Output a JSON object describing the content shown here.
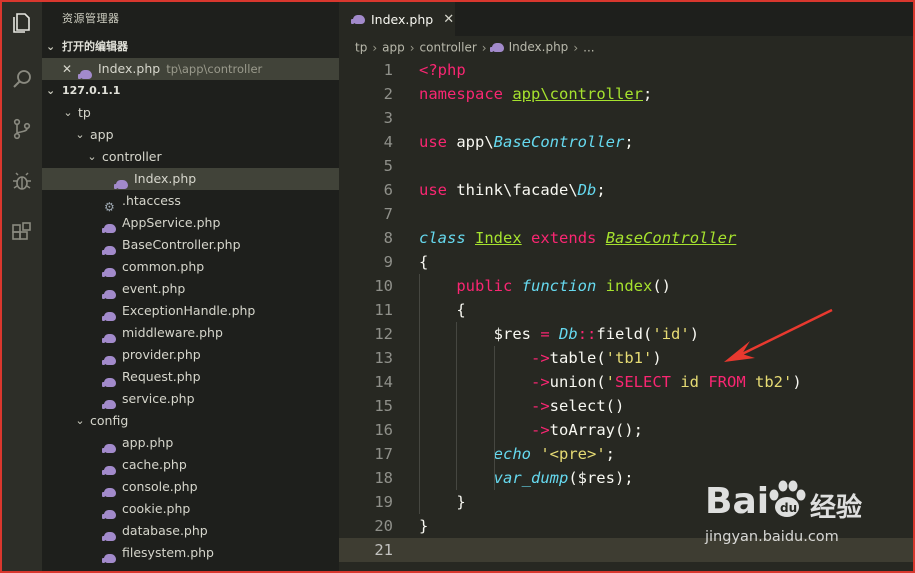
{
  "sidebar": {
    "title": "资源管理器",
    "open_editors_label": "打开的编辑器",
    "open_editor": {
      "name": "Index.php",
      "path": "tp\\app\\controller"
    },
    "workspace_label": "127.0.1.1",
    "tree": [
      {
        "name": "tp",
        "type": "folder",
        "depth": 0
      },
      {
        "name": "app",
        "type": "folder",
        "depth": 1
      },
      {
        "name": "controller",
        "type": "folder",
        "depth": 2
      },
      {
        "name": "Index.php",
        "type": "php",
        "depth": 3,
        "selected": true
      },
      {
        "name": ".htaccess",
        "type": "config",
        "depth": 2
      },
      {
        "name": "AppService.php",
        "type": "php",
        "depth": 2
      },
      {
        "name": "BaseController.php",
        "type": "php",
        "depth": 2
      },
      {
        "name": "common.php",
        "type": "php",
        "depth": 2
      },
      {
        "name": "event.php",
        "type": "php",
        "depth": 2
      },
      {
        "name": "ExceptionHandle.php",
        "type": "php",
        "depth": 2
      },
      {
        "name": "middleware.php",
        "type": "php",
        "depth": 2
      },
      {
        "name": "provider.php",
        "type": "php",
        "depth": 2
      },
      {
        "name": "Request.php",
        "type": "php",
        "depth": 2
      },
      {
        "name": "service.php",
        "type": "php",
        "depth": 2
      },
      {
        "name": "config",
        "type": "folder",
        "depth": 1
      },
      {
        "name": "app.php",
        "type": "php",
        "depth": 2
      },
      {
        "name": "cache.php",
        "type": "php",
        "depth": 2
      },
      {
        "name": "console.php",
        "type": "php",
        "depth": 2
      },
      {
        "name": "cookie.php",
        "type": "php",
        "depth": 2
      },
      {
        "name": "database.php",
        "type": "php",
        "depth": 2
      },
      {
        "name": "filesystem.php",
        "type": "php",
        "depth": 2
      }
    ]
  },
  "editor": {
    "tab_label": "Index.php",
    "breadcrumb": [
      "tp",
      "app",
      "controller",
      "Index.php",
      "..."
    ],
    "current_line": 21,
    "lines": [
      [
        [
          "k",
          "<?php"
        ]
      ],
      [
        [
          "k",
          "namespace"
        ],
        [
          "p",
          " "
        ],
        [
          "tu",
          "app\\controller"
        ],
        [
          "p",
          ";"
        ]
      ],
      [],
      [
        [
          "k",
          "use"
        ],
        [
          "p",
          " app\\"
        ],
        [
          "st",
          "BaseController"
        ],
        [
          "p",
          ";"
        ]
      ],
      [],
      [
        [
          "k",
          "use"
        ],
        [
          "p",
          " think\\facade\\"
        ],
        [
          "st",
          "Db"
        ],
        [
          "p",
          ";"
        ]
      ],
      [],
      [
        [
          "st",
          "class"
        ],
        [
          "p",
          " "
        ],
        [
          "tu",
          "Index"
        ],
        [
          "p",
          " "
        ],
        [
          "k",
          "extends"
        ],
        [
          "p",
          " "
        ],
        [
          "ti",
          "BaseController"
        ]
      ],
      [
        [
          "p",
          "{"
        ]
      ],
      [
        [
          "p",
          "    "
        ],
        [
          "k",
          "public"
        ],
        [
          "p",
          " "
        ],
        [
          "st",
          "function"
        ],
        [
          "p",
          " "
        ],
        [
          "f",
          "index"
        ],
        [
          "p",
          "()"
        ]
      ],
      [
        [
          "p",
          "    {"
        ]
      ],
      [
        [
          "p",
          "        "
        ],
        [
          "v",
          "$res"
        ],
        [
          "p",
          " "
        ],
        [
          "o",
          "="
        ],
        [
          "p",
          " "
        ],
        [
          "st",
          "Db"
        ],
        [
          "o",
          "::"
        ],
        [
          "p",
          "field("
        ],
        [
          "s",
          "'id'"
        ],
        [
          "p",
          ")"
        ]
      ],
      [
        [
          "p",
          "            "
        ],
        [
          "o",
          "->"
        ],
        [
          "p",
          "table("
        ],
        [
          "s",
          "'tb1'"
        ],
        [
          "p",
          ")"
        ]
      ],
      [
        [
          "p",
          "            "
        ],
        [
          "o",
          "->"
        ],
        [
          "p",
          "union("
        ],
        [
          "s",
          "'"
        ],
        [
          "k",
          "SELECT"
        ],
        [
          "s",
          " id "
        ],
        [
          "k",
          "FROM"
        ],
        [
          "s",
          " tb2'"
        ],
        [
          "p",
          ")"
        ]
      ],
      [
        [
          "p",
          "            "
        ],
        [
          "o",
          "->"
        ],
        [
          "p",
          "select()"
        ]
      ],
      [
        [
          "p",
          "            "
        ],
        [
          "o",
          "->"
        ],
        [
          "p",
          "toArray();"
        ]
      ],
      [
        [
          "p",
          "        "
        ],
        [
          "st",
          "echo"
        ],
        [
          "p",
          " "
        ],
        [
          "s",
          "'<pre>'"
        ],
        [
          "p",
          ";"
        ]
      ],
      [
        [
          "p",
          "        "
        ],
        [
          "st",
          "var_dump"
        ],
        [
          "p",
          "($res);"
        ]
      ],
      [
        [
          "p",
          "    }"
        ]
      ],
      [
        [
          "p",
          "}"
        ]
      ],
      []
    ]
  },
  "watermark": {
    "brand": "Bai",
    "brand2": "经验",
    "url": "jingyan.baidu.com"
  },
  "colors": {
    "keyword": "#f92672",
    "string": "#e6db74",
    "class_name": "#a6e22e",
    "storage": "#66d9ef",
    "arrow": "#e8392f",
    "border": "#d9372e"
  }
}
